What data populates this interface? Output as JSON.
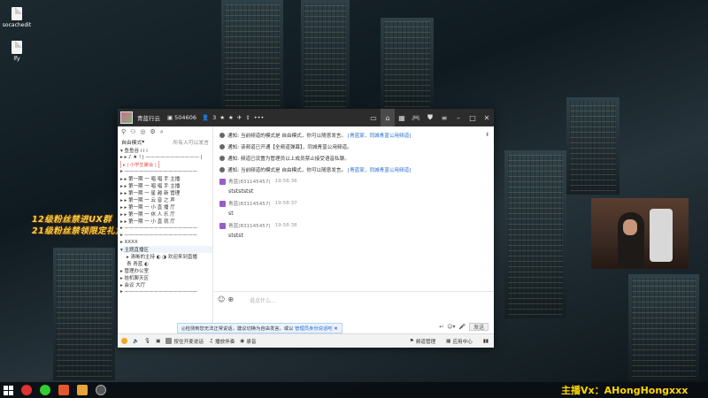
{
  "desktop": {
    "icons": [
      {
        "label": "socachedit",
        "icon": "document-icon"
      },
      {
        "label": "lfy",
        "icon": "document-icon"
      }
    ],
    "promo": [
      "12级粉丝禁进UX群",
      "21级粉丝禁领限定礼盒"
    ]
  },
  "titlebar": {
    "channel_name": "青蓝行云",
    "room_id": "504606",
    "online_count": "3",
    "stats_icons": [
      "star-icon",
      "star-icon",
      "plane-icon",
      "share-icon"
    ]
  },
  "left": {
    "header_left": "自由模式",
    "header_right": "所有人可以发言",
    "channels": [
      {
        "indent": 0,
        "text": "▾ 鱼鱼谷 i i i"
      },
      {
        "indent": 0,
        "text": "▸ ▸ ♪ ★ ! | ——————————— |"
      },
      {
        "indent": 0,
        "text": "▸ | 小学生聚会 |",
        "banner": true
      },
      {
        "indent": 0,
        "text": "▸ ———————————————"
      },
      {
        "indent": 0,
        "text": "▸ ▸ 第一期 一 唱  唱  手  主播"
      },
      {
        "indent": 0,
        "text": "▸ ▸ 第一期 一 唱  唱  手  主播"
      },
      {
        "indent": 0,
        "text": "▸ ▸ 第一期 一 星  越  新  管理"
      },
      {
        "indent": 0,
        "text": "▸ ▸ 第一期 一 云  音  之  声"
      },
      {
        "indent": 0,
        "text": "▸ ▸ 第一期 一 小  直  播  厅"
      },
      {
        "indent": 0,
        "text": "▸ ▸ 第一期 一 休  人  乐  厅"
      },
      {
        "indent": 0,
        "text": "▸ ▸ 第一期 一 小  直  就  厅"
      },
      {
        "indent": 0,
        "text": "▸ ———————————————"
      },
      {
        "indent": 0,
        "text": "▸ ———————————————"
      },
      {
        "indent": 0,
        "text": "▸  XXXX"
      },
      {
        "indent": 0,
        "text": "▾  主题直播区",
        "hl": true
      },
      {
        "indent": 1,
        "text": "▸ 清晰的主持 ◐ ◑ 欢迎来到直播"
      },
      {
        "indent": 1,
        "text": "青 青蓝 ◐"
      },
      {
        "indent": 0,
        "text": "▸  管理办公室"
      },
      {
        "indent": 0,
        "text": "▸  娃机聊天区"
      },
      {
        "indent": 0,
        "text": "▸  会议  大厅"
      },
      {
        "indent": 0,
        "text": "▸ ———————————————"
      }
    ]
  },
  "messages": {
    "system": [
      {
        "prefix": "通知:",
        "text": "当前频道的模式是 自由模式，你可以随意发言。",
        "link": "[青蓝家，同城青蓝公用频道]"
      },
      {
        "prefix": "通知:",
        "text": "该频道已开通【全频道弹幕】，同城青蓝公用频道。",
        "link": ""
      },
      {
        "prefix": "通知:",
        "text": "频道已设置为管理员以上成员禁止接受语音私聊。",
        "link": ""
      },
      {
        "prefix": "通知:",
        "text": "当前频道的模式是 自由模式，你可以随意发言。",
        "link": "[青蓝家，同城青蓝公用频道]"
      }
    ],
    "user": [
      {
        "name": "青蓝(831145457)",
        "time": "19:58:36",
        "text": "ststststst"
      },
      {
        "name": "青蓝(831145457)",
        "time": "19:58:37",
        "text": "st"
      },
      {
        "name": "青蓝(831145457)",
        "time": "19:58:38",
        "text": "ststst"
      }
    ]
  },
  "input": {
    "placeholder": "说点什么...",
    "send_label": "发送"
  },
  "statusbar": {
    "items": [
      "按住开麦说话",
      "播放伴奏",
      "录音"
    ],
    "right": [
      "频道管理",
      "应用中心"
    ]
  },
  "tooltip": {
    "text": "◎检测到您无法正常说话，建议切换为自由发言。或以",
    "link": "管理员身份说话吧"
  },
  "watermark": "主播Vx：AHongHongxxx",
  "colors": {
    "accent": "#2a6fd1",
    "titlebar": "#2c2c2c",
    "promo": "#f5d24a"
  }
}
